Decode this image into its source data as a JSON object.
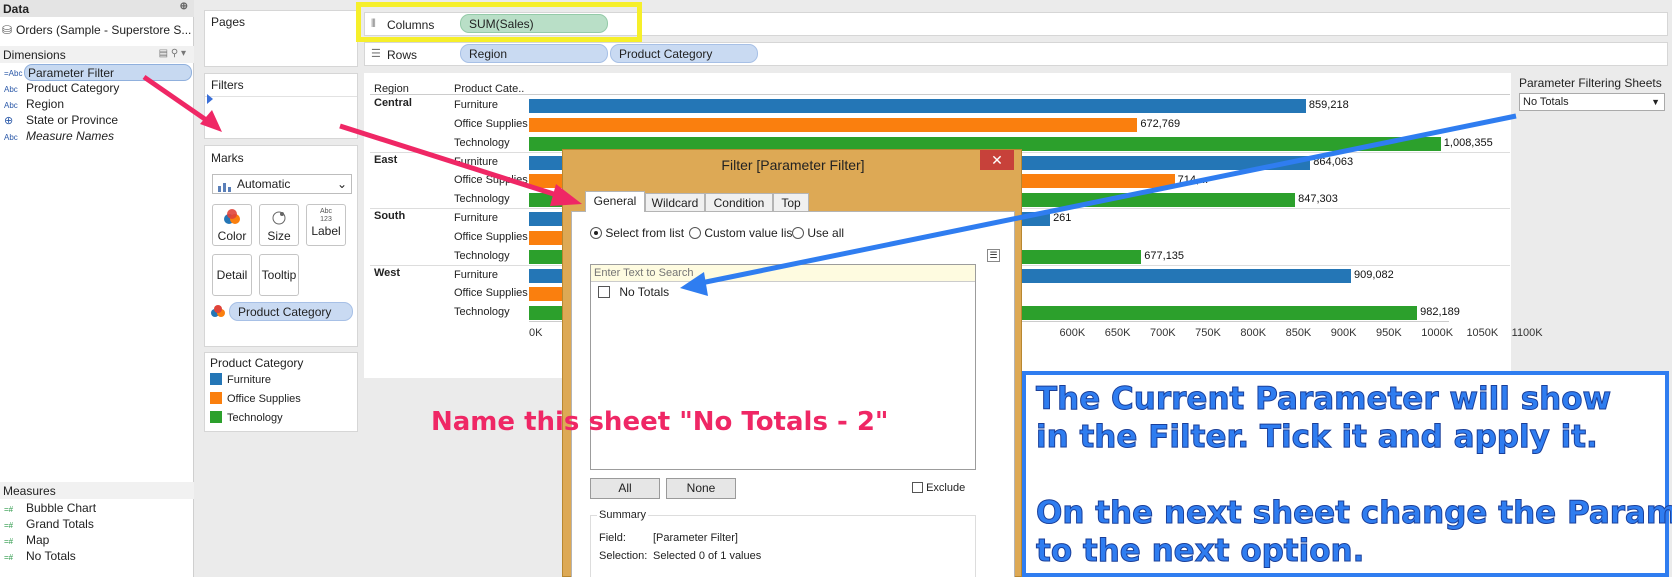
{
  "data_pane": {
    "title": "Data",
    "datasource": "Orders (Sample - Superstore S...",
    "dimensions_label": "Dimensions",
    "dimensions": [
      {
        "tag": "=Abc",
        "label": "Parameter Filter"
      },
      {
        "tag": "Abc",
        "label": "Product Category"
      },
      {
        "tag": "Abc",
        "label": "Region"
      },
      {
        "tag": "globe-icon",
        "label": "State or Province"
      },
      {
        "tag": "Abc",
        "label": "Measure Names"
      }
    ],
    "measures_label": "Measures",
    "measures": [
      {
        "tag": "=#",
        "label": "Bubble Chart"
      },
      {
        "tag": "=#",
        "label": "Grand Totals"
      },
      {
        "tag": "=#",
        "label": "Map"
      },
      {
        "tag": "=#",
        "label": "No Totals"
      }
    ]
  },
  "pages_label": "Pages",
  "filters_label": "Filters",
  "marks": {
    "label": "Marks",
    "type": "Automatic",
    "buttons": [
      "Color",
      "Size",
      "Label",
      "Detail",
      "Tooltip"
    ],
    "label_icon_text": "Abc\n123",
    "color_pill": "Product Category"
  },
  "legend": {
    "title": "Product Category",
    "items": [
      {
        "label": "Furniture",
        "color": "#2476b6"
      },
      {
        "label": "Office Supplies",
        "color": "#fa7f0e"
      },
      {
        "label": "Technology",
        "color": "#2ca02c"
      }
    ]
  },
  "shelves": {
    "columns_label": "Columns",
    "columns_pill": "SUM(Sales)",
    "rows_label": "Rows",
    "rows_pills": [
      "Region",
      "Product Category"
    ]
  },
  "parameter_control": {
    "title": "Parameter Filtering Sheets",
    "value": "No Totals"
  },
  "chart_data": {
    "type": "bar",
    "headers": [
      "Region",
      "Product Cate.."
    ],
    "groups": [
      {
        "region": "Central",
        "rows": [
          {
            "category": "Furniture",
            "value": 859218,
            "label": "859,218"
          },
          {
            "category": "Office Supplies",
            "value": 672769,
            "label": "672,769"
          },
          {
            "category": "Technology",
            "value": 1008355,
            "label": "1,008,355"
          }
        ]
      },
      {
        "region": "East",
        "rows": [
          {
            "category": "Furniture",
            "value": 864063,
            "label": "864,063"
          },
          {
            "category": "Office Supplies",
            "value": 714000,
            "label": "714,..."
          },
          {
            "category": "Technology",
            "value": 847303,
            "label": "847,303"
          }
        ]
      },
      {
        "region": "South",
        "rows": [
          {
            "category": "Furniture",
            "value": 576261,
            "label": "261"
          },
          {
            "category": "Office Supplies",
            "value": 400000,
            "label": ""
          },
          {
            "category": "Technology",
            "value": 677135,
            "label": "677,135"
          }
        ]
      },
      {
        "region": "West",
        "rows": [
          {
            "category": "Furniture",
            "value": 909082,
            "label": "909,082"
          },
          {
            "category": "Office Supplies",
            "value": 420000,
            "label": ""
          },
          {
            "category": "Technology",
            "value": 982189,
            "label": "982,189"
          }
        ]
      }
    ],
    "x_ticks_visible": [
      "0K",
      "600K",
      "650K",
      "700K",
      "750K",
      "800K",
      "850K",
      "900K",
      "950K",
      "1000K",
      "1050K",
      "1100K"
    ],
    "xlim": [
      0,
      1100000
    ],
    "colors": {
      "Furniture": "#2476b6",
      "Office Supplies": "#fa7f0e",
      "Technology": "#2ca02c"
    }
  },
  "dialog": {
    "title": "Filter [Parameter Filter]",
    "tabs": [
      "General",
      "Wildcard",
      "Condition",
      "Top"
    ],
    "radios": [
      "Select from list",
      "Custom value list",
      "Use all"
    ],
    "search_placeholder": "Enter Text to Search",
    "list_items": [
      "No Totals"
    ],
    "all_button": "All",
    "none_button": "None",
    "exclude_label": "Exclude",
    "summary_label": "Summary",
    "field_label": "Field:",
    "field_value": "[Parameter Filter]",
    "selection_label": "Selection:",
    "selection_value": "Selected 0 of 1 values"
  },
  "annotations": {
    "pink_note": "Name this sheet \"No Totals - 2\"",
    "blue_note_1": "The Current Parameter will show\nin the Filter. Tick it and apply it.",
    "blue_note_2": "On the next sheet change the Parameter\nto the next option."
  }
}
